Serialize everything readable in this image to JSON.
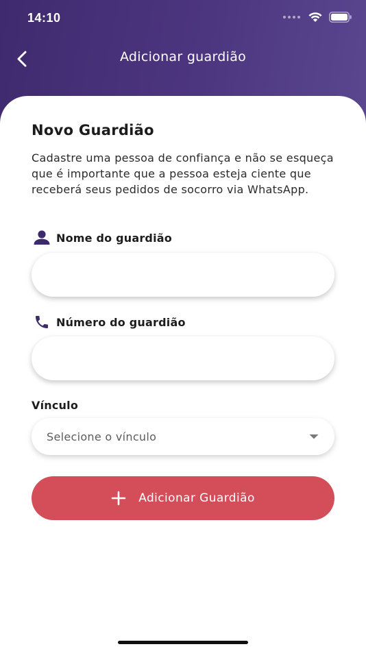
{
  "status_bar": {
    "time": "14:10"
  },
  "nav": {
    "title": "Adicionar guardião",
    "back_icon": "chevron-left-icon"
  },
  "form": {
    "title": "Novo Guardião",
    "description": "Cadastre uma pessoa de confiança e não se esqueça que é importante que a pessoa esteja ciente que receberá seus pedidos de socorro via WhatsApp.",
    "name_field": {
      "label": "Nome do guardião",
      "icon": "person-icon",
      "value": ""
    },
    "phone_field": {
      "label": "Número do guardião",
      "icon": "phone-icon",
      "value": ""
    },
    "relationship": {
      "label": "Vínculo",
      "placeholder": "Selecione o vínculo"
    },
    "submit_label": "Adicionar Guardião"
  },
  "colors": {
    "header_start": "#3f2a6e",
    "header_end": "#5a4790",
    "accent_icon": "#3d2a6b",
    "button": "#d44e5a"
  }
}
